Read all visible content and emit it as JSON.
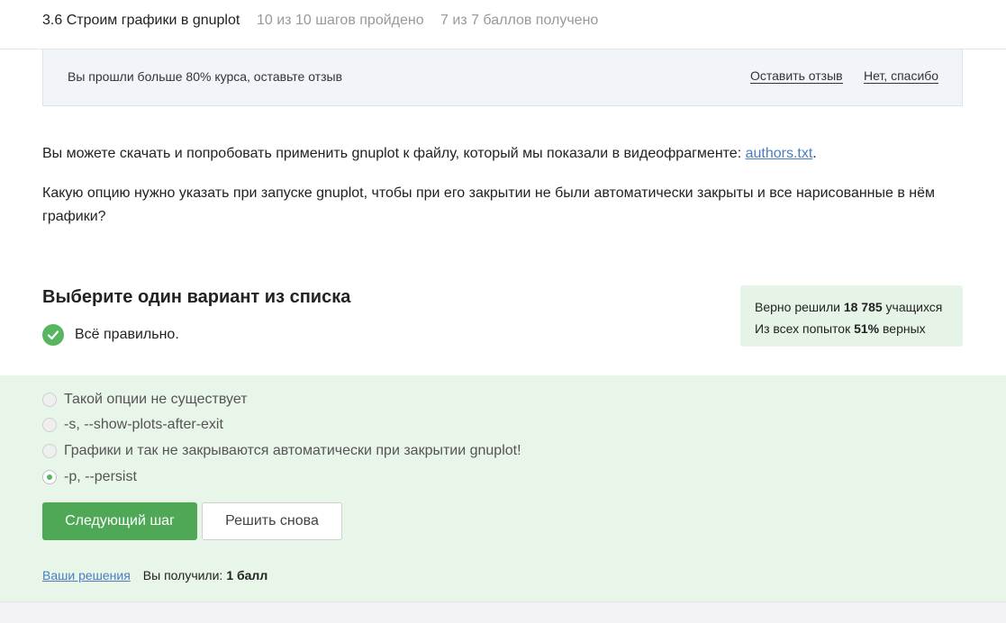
{
  "header": {
    "lesson_title": "3.6 Строим графики в gnuplot",
    "steps_progress": "10 из 10 шагов пройдено",
    "points_progress": "7 из 7 баллов  получено"
  },
  "banner": {
    "text": "Вы прошли больше 80% курса, оставьте отзыв",
    "leave_review_label": "Оставить отзыв",
    "no_thanks_label": "Нет, спасибо"
  },
  "content": {
    "download_text": "Вы можете скачать и попробовать применить gnuplot к файлу, который мы показали в видеофрагменте: ",
    "download_link": "authors.txt",
    "download_suffix": ".",
    "question": "Какую опцию нужно указать при запуске gnuplot, чтобы при его закрытии не были автоматически закрыты и все нарисованные в нём графики?"
  },
  "quiz": {
    "heading": "Выберите один вариант из списка",
    "status_text": "Всё правильно.",
    "options": [
      {
        "label": "Такой опции не существует",
        "selected": false
      },
      {
        "label": "-s, --show-plots-after-exit",
        "selected": false
      },
      {
        "label": "Графики и так не закрываются автоматически при закрытии gnuplot!",
        "selected": false
      },
      {
        "label": "-p, --persist",
        "selected": true
      }
    ],
    "next_button": "Следующий шаг",
    "retry_button": "Решить снова",
    "solutions_link": "Ваши решения",
    "received_label": "Вы получили:",
    "received_points": "1 балл"
  },
  "stats": {
    "solved_prefix": "Верно решили ",
    "solved_count": "18 785",
    "solved_suffix": " учащихся",
    "attempts_prefix": "Из всех попыток ",
    "attempts_percent": "51%",
    "attempts_suffix": " верных"
  },
  "colors": {
    "accent_green": "#59b660",
    "button_green": "#4fa855",
    "answers_bg": "#e8f5e9",
    "link_blue": "#4a7dbf"
  }
}
